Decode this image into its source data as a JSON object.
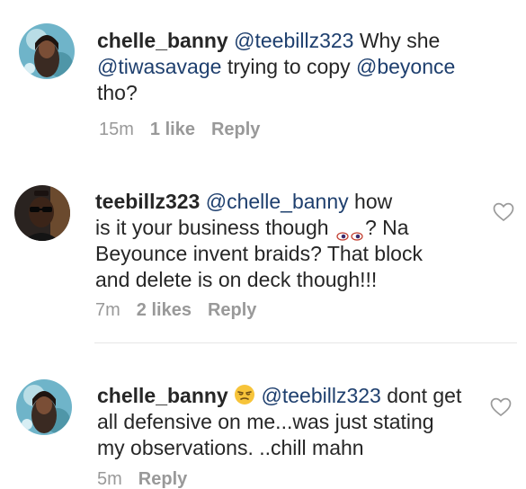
{
  "comments": [
    {
      "username": "chelle_banny",
      "mention1": "@teebillz323",
      "text1": "Why she",
      "mention2": "@tiwasavage",
      "text2": "trying to copy",
      "mention3": "@beyonce",
      "text3": "tho?",
      "time": "15m",
      "likes": "1 like",
      "reply": "Reply"
    },
    {
      "username": "teebillz323",
      "mention1": "@chelle_banny",
      "text1": "how",
      "text2": "is it your business though",
      "text3": "? Na",
      "text4": "Beyounce invent braids? That block",
      "text5": "and delete is on deck though!!!",
      "time": "7m",
      "likes": "2 likes",
      "reply": "Reply"
    },
    {
      "username": "chelle_banny",
      "mention1": "@teebillz323",
      "text1": "dont get",
      "text2": "all defensive on me...was just stating",
      "text3": "my observations. ..chill mahn",
      "time": "5m",
      "reply": "Reply"
    }
  ],
  "colors": {
    "text": "#262626",
    "mention": "#1e3f6e",
    "meta": "#999999",
    "divider": "#e6e6e6"
  },
  "icons": {
    "like": "heart-outline-icon",
    "emoji_eyes": "eyes-emoji-icon",
    "emoji_face": "unamused-face-emoji-icon"
  }
}
